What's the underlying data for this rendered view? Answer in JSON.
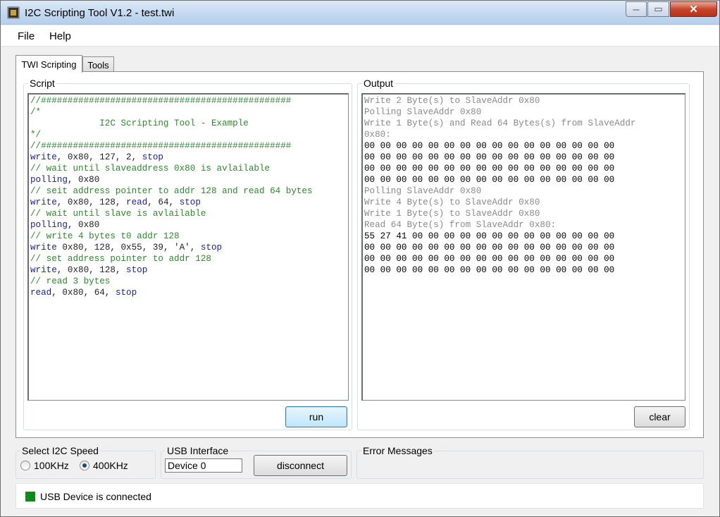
{
  "window": {
    "title": "I2C Scripting Tool V1.2 - test.twi",
    "minimize_label": "─",
    "maximize_label": "▭",
    "close_label": "✕"
  },
  "menu": {
    "file": "File",
    "help": "Help"
  },
  "tabs": {
    "active": "TWI Scripting",
    "inactive": "Tools"
  },
  "script": {
    "label": "Script",
    "run_label": "run",
    "lines": [
      [
        [
          "c",
          "//###############################################"
        ]
      ],
      [
        [
          "c",
          "/*"
        ]
      ],
      [
        [
          "c",
          "             I2C Scripting Tool - Example"
        ]
      ],
      [
        [
          "c",
          "*/"
        ]
      ],
      [
        [
          "c",
          "//###############################################"
        ]
      ],
      [
        [
          "k",
          "write"
        ],
        [
          "p",
          ", 0x80, 127, 2, "
        ],
        [
          "k",
          "stop"
        ]
      ],
      [
        [
          "c",
          "// wait until slaveaddress 0x80 is avlailable"
        ]
      ],
      [
        [
          "k",
          "polling"
        ],
        [
          "p",
          ", 0x80"
        ]
      ],
      [
        [
          "c",
          "// seit address pointer to addr 128 and read 64 bytes"
        ]
      ],
      [
        [
          "k",
          "write"
        ],
        [
          "p",
          ", 0x80, 128, "
        ],
        [
          "k",
          "read"
        ],
        [
          "p",
          ", 64, "
        ],
        [
          "k",
          "stop"
        ]
      ],
      [
        [
          "c",
          "// wait until slave is avlailable"
        ]
      ],
      [
        [
          "k",
          "polling"
        ],
        [
          "p",
          ", 0x80"
        ]
      ],
      [
        [
          "c",
          "// write 4 bytes t0 addr 128"
        ]
      ],
      [
        [
          "k",
          "write"
        ],
        [
          "p",
          " 0x80, 128, 0x55, 39, 'A', "
        ],
        [
          "k",
          "stop"
        ]
      ],
      [
        [
          "c",
          "// set address pointer to addr 128"
        ]
      ],
      [
        [
          "k",
          "write"
        ],
        [
          "p",
          ", 0x80, 128, "
        ],
        [
          "k",
          "stop"
        ]
      ],
      [
        [
          "c",
          "// read 3 bytes"
        ]
      ],
      [
        [
          "k",
          "read"
        ],
        [
          "p",
          ", 0x80, 64, "
        ],
        [
          "k",
          "stop"
        ]
      ]
    ]
  },
  "output": {
    "label": "Output",
    "clear_label": "clear",
    "lines": [
      [
        [
          "g",
          "Write 2 Byte(s) to SlaveAddr 0x80"
        ]
      ],
      [
        [
          "g",
          "Polling SlaveAddr 0x80"
        ]
      ],
      [
        [
          "g",
          "Write 1 Byte(s) and Read 64 Bytes(s) from SlaveAddr"
        ]
      ],
      [
        [
          "g",
          "0x80:"
        ]
      ],
      [
        [
          "d",
          "00 00 00 00 00 00 00 00 00 00 00 00 00 00 00 00"
        ]
      ],
      [
        [
          "d",
          "00 00 00 00 00 00 00 00 00 00 00 00 00 00 00 00"
        ]
      ],
      [
        [
          "d",
          "00 00 00 00 00 00 00 00 00 00 00 00 00 00 00 00"
        ]
      ],
      [
        [
          "d",
          "00 00 00 00 00 00 00 00 00 00 00 00 00 00 00 00"
        ]
      ],
      [
        [
          "g",
          "Polling SlaveAddr 0x80"
        ]
      ],
      [
        [
          "g",
          "Write 4 Byte(s) to SlaveAddr 0x80"
        ]
      ],
      [
        [
          "g",
          "Write 1 Byte(s) to SlaveAddr 0x80"
        ]
      ],
      [
        [
          "g",
          "Read 64 Byte(s) from SlaveAddr 0x80:"
        ]
      ],
      [
        [
          "d",
          "55 27 41 00 00 00 00 00 00 00 00 00 00 00 00 00"
        ]
      ],
      [
        [
          "d",
          "00 00 00 00 00 00 00 00 00 00 00 00 00 00 00 00"
        ]
      ],
      [
        [
          "d",
          "00 00 00 00 00 00 00 00 00 00 00 00 00 00 00 00"
        ]
      ],
      [
        [
          "d",
          "00 00 00 00 00 00 00 00 00 00 00 00 00 00 00 00"
        ]
      ]
    ]
  },
  "i2c_speed": {
    "label": "Select I2C Speed",
    "options": [
      "100KHz",
      "400KHz"
    ],
    "selected": "400KHz"
  },
  "usb": {
    "label": "USB Interface",
    "device_value": "Device 0",
    "disconnect_label": "disconnect"
  },
  "errors": {
    "label": "Error Messages"
  },
  "status": {
    "text": "USB Device is connected",
    "led_color": "#0e8a18"
  },
  "colors": {
    "comment": "#2b8a2b",
    "keyword": "#1a1ab3",
    "log_text": "#8a8a8a"
  },
  "icons": {
    "app": "chip-icon",
    "minimize": "minimize-icon",
    "maximize": "maximize-icon",
    "close": "close-icon"
  }
}
